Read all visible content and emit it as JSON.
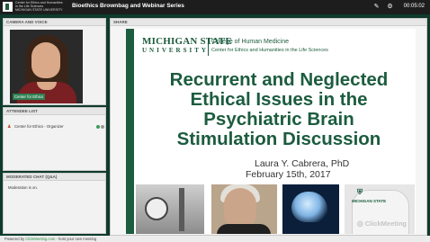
{
  "app": {
    "logo_text": "Center for Ethics and Humanities\nin the Life Sciences\nMICHIGAN STATE UNIVERSITY",
    "title": "Bioethics Brownbag and Webinar Series",
    "timer": "00:05:02",
    "icons": [
      "pen-icon",
      "settings-icon"
    ]
  },
  "camera": {
    "header": "CAMERA AND VOICE",
    "label": "Center for Ethics"
  },
  "attendees": {
    "header": "ATTENDEE LIST",
    "items": [
      {
        "name": "Center for Ethics - Organizer"
      }
    ]
  },
  "chat": {
    "header": "MODERATED CHAT (Q&A)",
    "messages": [
      "Moderation is on."
    ]
  },
  "share": {
    "header": "SHARE",
    "msu_name": "MICHIGAN STATE",
    "msu_university": "UNIVERSITY",
    "college": "College of Human Medicine",
    "center": "Center for Ethics and Humanities in the Life Sciences",
    "title": "Recurrent and Neglected\nEthical Issues in the\nPsychiatric Brain\nStimulation Discussion",
    "author": "Laura Y. Cabrera, PhD",
    "date": "February 15th, 2017",
    "shirt_text": "MICHIGAN STATE",
    "watermark": "ClickMeeting"
  },
  "footer": {
    "prefix": "Powered by ",
    "brand": "ClickMeeting.com",
    "suffix": " - host your own meeting"
  },
  "colors": {
    "msu_green": "#1c5c3f",
    "background": "#0f3b2c",
    "topbar": "#1d1d1d"
  }
}
